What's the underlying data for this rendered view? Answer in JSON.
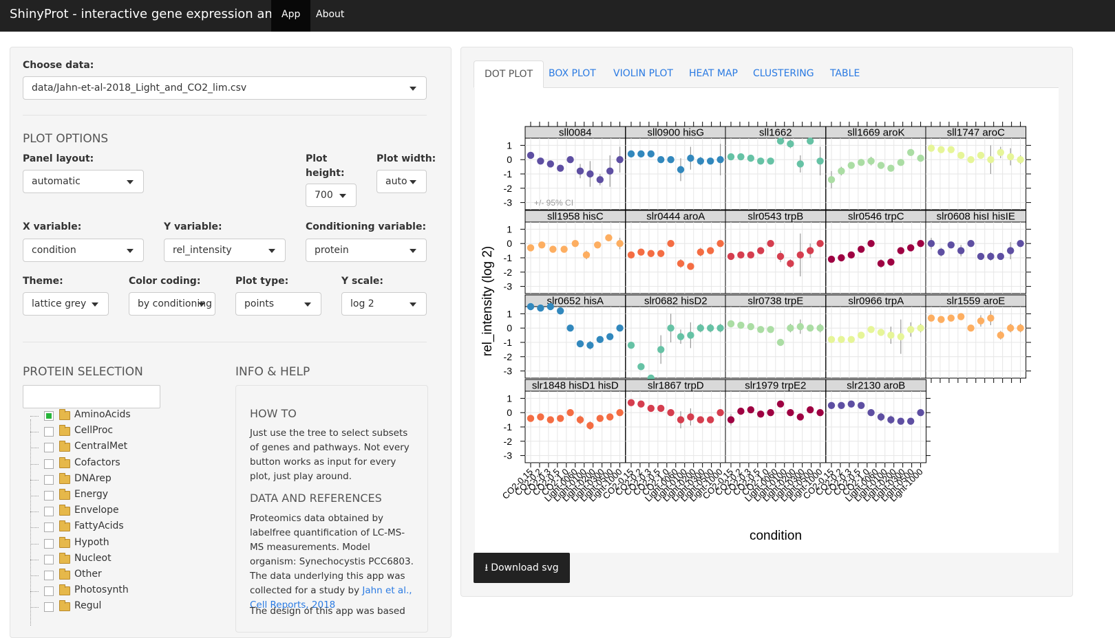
{
  "navbar": {
    "title": "ShinyProt - interactive gene expression analysis",
    "items": [
      {
        "label": "App",
        "active": true
      },
      {
        "label": "About",
        "active": false
      }
    ]
  },
  "sidebar": {
    "choose_data": {
      "label": "Choose data:",
      "value": "data/Jahn-et-al-2018_Light_and_CO2_lim.csv"
    },
    "plot_options": {
      "title": "PLOT OPTIONS",
      "panel_layout": {
        "label": "Panel layout:",
        "value": "automatic"
      },
      "plot_height": {
        "label_line1": "Plot",
        "label_line2": "height:",
        "value": "700"
      },
      "plot_width": {
        "label": "Plot width:",
        "value": "auto"
      },
      "x_variable": {
        "label": "X variable:",
        "value": "condition"
      },
      "y_variable": {
        "label": "Y variable:",
        "value": "rel_intensity"
      },
      "conditioning_variable": {
        "label": "Conditioning variable:",
        "value": "protein"
      },
      "theme": {
        "label": "Theme:",
        "value": "lattice grey"
      },
      "color_coding": {
        "label": "Color coding:",
        "value": "by conditioning"
      },
      "plot_type": {
        "label": "Plot type:",
        "value": "points"
      },
      "y_scale": {
        "label": "Y scale:",
        "value": "log 2"
      }
    },
    "protein_selection": {
      "title": "PROTEIN SELECTION",
      "search_value": "",
      "tree": [
        {
          "label": "AminoAcids",
          "checked": true
        },
        {
          "label": "CellProc",
          "checked": false
        },
        {
          "label": "CentralMet",
          "checked": false
        },
        {
          "label": "Cofactors",
          "checked": false
        },
        {
          "label": "DNArep",
          "checked": false
        },
        {
          "label": "Energy",
          "checked": false
        },
        {
          "label": "Envelope",
          "checked": false
        },
        {
          "label": "FattyAcids",
          "checked": false
        },
        {
          "label": "Hypoth",
          "checked": false
        },
        {
          "label": "Nucleot",
          "checked": false
        },
        {
          "label": "Other",
          "checked": false
        },
        {
          "label": "Photosynth",
          "checked": false
        },
        {
          "label": "Regul",
          "checked": false
        }
      ]
    },
    "info": {
      "title": "INFO & HELP",
      "howto_title": "HOW TO",
      "howto_text": "Just use the tree to select subsets of genes and pathways. Not every button works as input for every plot, just play around.",
      "data_title": "DATA AND REFERENCES",
      "data_text": "Proteomics data obtained by labelfree quantification of LC-MS-MS measurements. Model organism: Synechocystis PCC6803. The data underlying this app was collected for a study by ",
      "data_link": "Jahn et al., Cell Reports, 2018",
      "trailing_text": "The design of this app was based"
    }
  },
  "main": {
    "tabs": [
      {
        "label": "DOT PLOT",
        "active": true
      },
      {
        "label": "BOX PLOT",
        "active": false
      },
      {
        "label": "VIOLIN PLOT",
        "active": false
      },
      {
        "label": "HEAT MAP",
        "active": false
      },
      {
        "label": "CLUSTERING",
        "active": false
      },
      {
        "label": "TABLE",
        "active": false
      }
    ],
    "download_label": "Download svg"
  },
  "chart_data": {
    "type": "scatter",
    "xlabel": "condition",
    "ylabel": "rel_intensity (log 2)",
    "ylim": [
      -3.5,
      1.5
    ],
    "yticks": [
      1,
      0,
      -1,
      -2,
      -3
    ],
    "annotation": "+/- 95% CI",
    "conditions": [
      "CO2-0.15",
      "CO2-0.2",
      "CO2-0.3",
      "CO2-0.5",
      "CO2-1.0",
      "Light-0060",
      "Light-0100",
      "Light-0200",
      "Light-0300",
      "Light-0500",
      "Light-1000"
    ],
    "panels": [
      {
        "name": "sll0084",
        "color": "#5e4fa2",
        "values": [
          0.3,
          -0.1,
          -0.3,
          -0.6,
          -0.0,
          -0.8,
          -1.0,
          -1.4,
          -0.8,
          -0.0
        ],
        "ci": [
          0.1,
          0.1,
          0.1,
          0.1,
          0.1,
          0.5,
          0.9,
          0.4,
          1.1,
          0.9
        ]
      },
      {
        "name": "sll0900 hisG",
        "color": "#3288bd",
        "values": [
          0.4,
          0.4,
          0.4,
          0.0,
          0.0,
          -0.7,
          0.1,
          -0.1,
          -0.1,
          0.0
        ],
        "ci": [
          0.1,
          0.1,
          0.1,
          0.1,
          0.1,
          0.8,
          0.8,
          0.3,
          0.2,
          1.1
        ]
      },
      {
        "name": "sll1662",
        "color": "#66c2a5",
        "values": [
          0.2,
          0.2,
          0.1,
          -0.1,
          -0.1,
          1.3,
          1.1,
          -0.3,
          1.3,
          -0.1
        ],
        "ci": [
          0.1,
          0.1,
          0.1,
          0.1,
          0.1,
          0.1,
          0.3,
          0.6,
          0.1,
          1.0
        ]
      },
      {
        "name": "sll1669 aroK",
        "color": "#abdda4",
        "values": [
          -1.4,
          -0.8,
          -0.4,
          -0.2,
          -0.1,
          -0.4,
          -0.6,
          -0.2,
          0.5,
          0.1
        ],
        "ci": [
          0.6,
          0.3,
          0.2,
          0.2,
          0.3,
          0.2,
          0.2,
          0.1,
          0.1,
          0.1
        ]
      },
      {
        "name": "sll1747 aroC",
        "color": "#e6f598",
        "values": [
          0.8,
          0.7,
          0.7,
          0.3,
          0.0,
          0.3,
          0.0,
          0.5,
          0.2,
          0.0
        ],
        "ci": [
          0.1,
          0.1,
          0.1,
          0.1,
          0.1,
          0.2,
          1.0,
          0.4,
          0.6,
          0.3
        ]
      },
      {
        "name": "sll1958 hisC",
        "color": "#fdae61",
        "values": [
          -0.3,
          -0.1,
          -0.4,
          -0.4,
          0.0,
          -0.8,
          -0.1,
          0.4,
          0.0
        ],
        "ci": [
          0.2,
          0.1,
          0.1,
          0.1,
          0.1,
          0.3,
          0.1,
          0.1,
          0.4
        ]
      },
      {
        "name": "slr0444 aroA",
        "color": "#f46d43",
        "values": [
          -0.8,
          -0.6,
          -0.7,
          -0.7,
          0.0,
          -1.4,
          -1.6,
          -0.6,
          -0.5,
          0.0
        ],
        "ci": [
          0.1,
          0.1,
          0.1,
          0.1,
          0.1,
          0.3,
          0.2,
          0.3,
          0.2,
          0.1
        ]
      },
      {
        "name": "slr0543 trpB",
        "color": "#d53e4f",
        "values": [
          -0.9,
          -0.8,
          -0.8,
          -0.5,
          0.0,
          -0.9,
          -1.4,
          -0.8,
          -0.5,
          0.0
        ],
        "ci": [
          0.1,
          0.1,
          0.1,
          0.1,
          0.1,
          0.4,
          0.3,
          1.5,
          0.5,
          0.1
        ]
      },
      {
        "name": "slr0546 trpC",
        "color": "#9e0142",
        "values": [
          -1.1,
          -1.0,
          -0.8,
          -0.4,
          0.0,
          -1.4,
          -1.3,
          -0.5,
          -0.3,
          0.0
        ],
        "ci": [
          0.1,
          0.1,
          0.1,
          0.1,
          0.1,
          0.3,
          0.1,
          0.1,
          0.1,
          0.2
        ]
      },
      {
        "name": "slr0608 hisI hisIE",
        "color": "#5e4fa2",
        "values": [
          0.0,
          -0.6,
          -0.1,
          -0.5,
          0.0,
          -0.9,
          -0.9,
          -0.9,
          -0.5,
          0.0
        ],
        "ci": [
          0.4,
          0.3,
          0.1,
          0.4,
          0.1,
          0.2,
          0.3,
          0.2,
          0.6,
          0.2
        ]
      },
      {
        "name": "slr0652 hisA",
        "color": "#3288bd",
        "values": [
          1.5,
          1.4,
          1.5,
          1.2,
          0.0,
          -1.1,
          -1.2,
          -0.8,
          -0.6,
          0.0
        ],
        "ci": [
          0.1,
          0.1,
          0.1,
          0.2,
          0.1,
          0.2,
          0.3,
          0.1,
          0.1,
          0.1
        ]
      },
      {
        "name": "slr0682 hisD2",
        "color": "#66c2a5",
        "values": [
          -1.2,
          -2.7,
          -3.5,
          -1.5,
          0.0,
          -0.6,
          -0.5,
          0.0,
          0.0,
          0.0
        ],
        "ci": [
          0.1,
          0.2,
          0.1,
          1.0,
          1.0,
          0.5,
          0.9,
          0.3,
          0.3,
          0.3
        ]
      },
      {
        "name": "slr0738 trpE",
        "color": "#abdda4",
        "values": [
          0.3,
          0.2,
          0.1,
          -0.1,
          -0.1,
          -1.0,
          0.0,
          0.1,
          0.0,
          0.0
        ],
        "ci": [
          0.1,
          0.1,
          0.1,
          0.1,
          0.1,
          0.1,
          0.3,
          0.5,
          0.1,
          0.3
        ]
      },
      {
        "name": "slr0966 trpA",
        "color": "#e6f598",
        "values": [
          -0.8,
          -0.8,
          -0.8,
          -0.5,
          -0.1,
          -0.3,
          -0.5,
          -0.6,
          -0.1,
          0.0
        ],
        "ci": [
          0.1,
          0.1,
          0.1,
          0.1,
          0.1,
          0.1,
          0.6,
          1.2,
          0.5,
          0.3
        ]
      },
      {
        "name": "slr1559 aroE",
        "color": "#fdae61",
        "values": [
          0.7,
          0.6,
          0.7,
          0.8,
          0.0,
          0.5,
          0.7,
          -0.5,
          0.0,
          0.0
        ],
        "ci": [
          0.1,
          0.1,
          0.1,
          0.1,
          0.1,
          0.4,
          0.5,
          0.3,
          0.3,
          0.3
        ]
      },
      {
        "name": "slr1848 hisD1 hisD",
        "color": "#f46d43",
        "values": [
          -0.4,
          -0.3,
          -0.5,
          -0.4,
          0.0,
          -0.5,
          -0.9,
          -0.4,
          -0.3,
          0.0
        ],
        "ci": [
          0.1,
          0.1,
          0.1,
          0.1,
          0.1,
          0.3,
          0.3,
          0.1,
          0.1,
          0.1
        ]
      },
      {
        "name": "slr1867 trpD",
        "color": "#d53e4f",
        "values": [
          0.7,
          0.6,
          0.3,
          0.3,
          0.0,
          -0.5,
          -0.3,
          -0.5,
          -0.5,
          0.0
        ],
        "ci": [
          0.1,
          0.1,
          0.1,
          0.1,
          0.1,
          0.6,
          0.6,
          0.2,
          0.2,
          0.1
        ]
      },
      {
        "name": "slr1979 trpE2",
        "color": "#9e0142",
        "values": [
          -0.5,
          0.1,
          0.2,
          -0.1,
          0.0,
          0.6,
          0.0,
          -0.3,
          0.2,
          0.0
        ],
        "ci": [
          0.4,
          0.1,
          0.1,
          0.1,
          0.1,
          0.1,
          0.1,
          0.1,
          0.1,
          0.1
        ]
      },
      {
        "name": "slr2130 aroB",
        "color": "#5e4fa2",
        "values": [
          0.5,
          0.5,
          0.6,
          0.5,
          0.0,
          -0.3,
          -0.5,
          -0.6,
          -0.6,
          0.0
        ],
        "ci": [
          0.1,
          0.1,
          0.1,
          0.1,
          0.1,
          0.3,
          0.3,
          0.2,
          0.1,
          0.1
        ]
      }
    ]
  }
}
